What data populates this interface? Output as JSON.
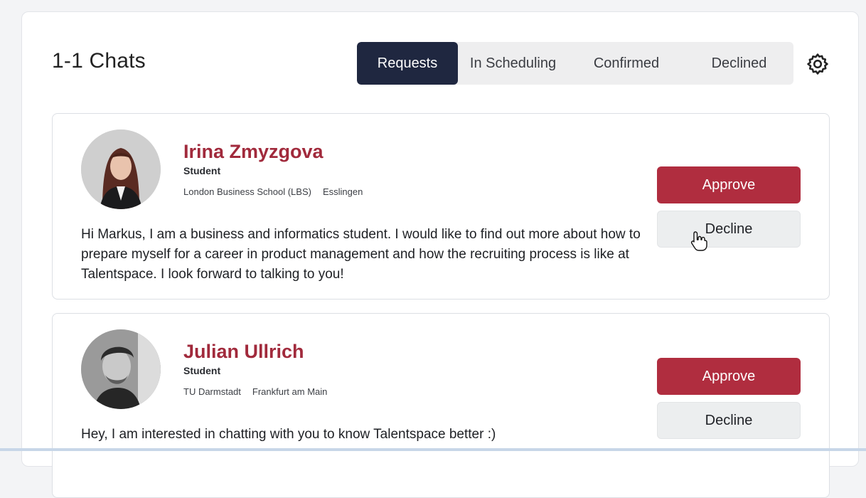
{
  "header": {
    "title": "1-1 Chats",
    "settings_icon": "gear-icon"
  },
  "tabs": [
    {
      "label": "Requests",
      "active": true
    },
    {
      "label": "In Scheduling",
      "active": false
    },
    {
      "label": "Confirmed",
      "active": false
    },
    {
      "label": "Declined",
      "active": false
    }
  ],
  "requests": [
    {
      "name": "Irina Zmyzgova",
      "role": "Student",
      "school": "London Business School (LBS)",
      "location": "Esslingen",
      "message": "Hi Markus, I am a business and informatics student. I would like to find out more about how to prepare myself for a career in product management and how the recruiting process is like at Talentspace. I look forward to talking to you!",
      "approve_label": "Approve",
      "decline_label": "Decline"
    },
    {
      "name": "Julian Ullrich",
      "role": "Student",
      "school": "TU Darmstadt",
      "location": "Frankfurt am Main",
      "message": "Hey, I am interested in chatting with you to know Talentspace better :)",
      "approve_label": "Approve",
      "decline_label": "Decline"
    }
  ],
  "colors": {
    "accent": "#b02d3f",
    "name": "#a12a3c",
    "active_tab": "#1f2740"
  }
}
